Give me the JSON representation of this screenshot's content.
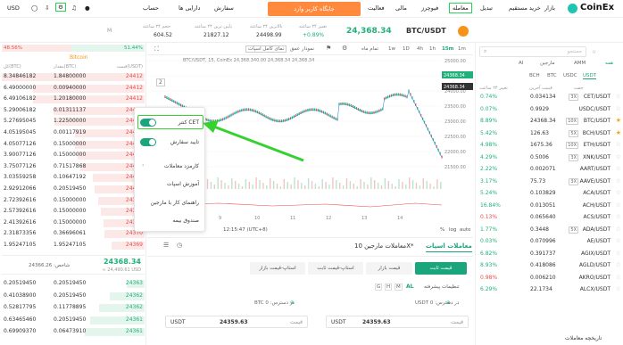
{
  "nav": {
    "logo": "CoinEx",
    "items": [
      "بازار",
      "خرید مستقیم",
      "تبدیل",
      "معامله",
      "فیوچرز",
      "مالی",
      "فعالیت"
    ],
    "highlight_index": 3,
    "banner": "جایگاه کاربر وارد",
    "right_items": [
      "سفارش",
      "دارایی ها",
      "حساب"
    ],
    "currency": "USD"
  },
  "ticker": {
    "pair": "BTC/USDT",
    "price": "24,368.34",
    "stats": [
      {
        "label": "تغییر ۲۴ ساعته",
        "value": "+0.89%"
      },
      {
        "label": "بالاترین ۲۴ ساعته",
        "value": "24498.99"
      },
      {
        "label": "پایین ترین ۲۴ ساعته",
        "value": "21827.12"
      },
      {
        "label": "حجم ۲۴ ساعته",
        "value": "604.52"
      }
    ],
    "m_label": "M"
  },
  "book": {
    "coin_label": "Bitcoin",
    "pct_left": "48.56%",
    "pct_right": "51.44%",
    "headers": [
      "قیمت(USDT)",
      "مقدار(BTC)",
      "کل(BTC)"
    ],
    "asks": [
      [
        "24412",
        "1.84800000",
        "8.34846182"
      ],
      [
        "24412",
        "0.00940000",
        "6.49000000"
      ],
      [
        "24412",
        "1.20180000",
        "6.49106182"
      ],
      [
        "24409",
        "0.01311137",
        "5.29006182"
      ],
      [
        "24407",
        "1.22500000",
        "5.27695045"
      ],
      [
        "24406",
        "0.00117919",
        "4.05195045"
      ],
      [
        "24406",
        "0.15000000",
        "4.05077126"
      ],
      [
        "24405",
        "0.15000000",
        "3.90077126"
      ],
      [
        "24404",
        "0.71517868",
        "3.75077126"
      ],
      [
        "24403",
        "0.10647192",
        "3.03559258"
      ],
      [
        "24401",
        "0.20519450",
        "2.92912066"
      ],
      [
        "24397",
        "0.15000000",
        "2.72392616"
      ],
      [
        "24395",
        "0.15000000",
        "2.57392616"
      ],
      [
        "24391",
        "0.15000000",
        "2.41392616"
      ],
      [
        "24370",
        "0.36696061",
        "2.31873356"
      ],
      [
        "24369",
        "1.95247105",
        "1.95247105"
      ]
    ],
    "mid_price": "24368.34",
    "mid_sub": "≈ 24,490.61 USD",
    "spread_label": "24366.26 :شاخص",
    "bids": [
      [
        "24363",
        "0.20519450",
        "0.20519450"
      ],
      [
        "24362",
        "0.20519450",
        "0.41038900"
      ],
      [
        "24362",
        "0.11778895",
        "0.52817795"
      ],
      [
        "24361",
        "0.20519450",
        "0.63465460"
      ],
      [
        "24361",
        "0.06473910",
        "0.69909370"
      ]
    ]
  },
  "chart": {
    "toolbar": [
      "1m",
      "15m",
      "1h",
      "4h",
      "1D",
      "1w",
      "تمام ماه"
    ],
    "active_interval": "15m",
    "tabs": [
      "نمودار عمق",
      "نمای کامل اسپات"
    ],
    "ohlc_label": "BTC/USDT, 15, CoinEx 24,368.340.00 24,368.34 24,368.34",
    "price_tag": "24368.34",
    "price_tag2": "24368.34",
    "y_ticks": [
      "25000.00",
      "24500.00",
      "24000.00",
      "23500.00",
      "23000.00",
      "22500.00",
      "22000.00",
      "21500.00"
    ],
    "x_ticks": [
      "9",
      "10",
      "11",
      "12",
      "13",
      "14"
    ],
    "time_label": "12:15:47 (UTC+8)",
    "log_label": "log",
    "auto_label": "auto",
    "pct_label": "%",
    "ind_label": "2"
  },
  "menu": {
    "items": [
      "کنتر CET",
      "تایید سفارش",
      "کارمزد معاملات",
      "آموزش اسپات",
      "راهنمای کار با مارجین",
      "صندوق بیمه"
    ]
  },
  "trade": {
    "tabs": [
      "معاملات اسپات",
      "معاملات مارجین 10X*"
    ],
    "order_types": [
      "قیمت ثابت",
      "قیمت بازار",
      "استاپ-قیمت ثابت",
      "استاپ-قیمت بازار"
    ],
    "pair_sel": "AL",
    "fee_label": "تنظیمات پیشرفته",
    "buy_col": {
      "avail": "USDT 0 :در دسترس",
      "price_label": "قیمت",
      "price": "24359.63",
      "unit": "USDT"
    },
    "sell_col": {
      "avail": "BTC 0 :در دسترس",
      "price_label": "قیمت",
      "price": "24359.63",
      "unit": "USDT"
    }
  },
  "market": {
    "search_placeholder": "جستجو",
    "tabs": [
      "همه",
      "AMM",
      "مارجین",
      "AI"
    ],
    "quote_tabs": [
      "USDT",
      "USDC",
      "BTC",
      "BCH"
    ],
    "headers": [
      "جفت",
      "قیمت آخرین",
      "تغییر ۲۴ ساعت"
    ],
    "rows": [
      {
        "pair": "CET/USDT",
        "lev": "3X",
        "price": "0.034134",
        "change": "0.74%",
        "dir": "up",
        "star": false
      },
      {
        "pair": "USDC/USDT",
        "lev": "",
        "price": "0.9929",
        "change": "0.07%",
        "dir": "up",
        "star": false
      },
      {
        "pair": "BTC/USDT",
        "lev": "10X",
        "price": "24368.34",
        "change": "8.89%",
        "dir": "up",
        "star": true
      },
      {
        "pair": "BCH/USDT",
        "lev": "5X",
        "price": "126.63",
        "change": "5.42%",
        "dir": "up",
        "star": true
      },
      {
        "pair": "ETH/USDT",
        "lev": "10X",
        "price": "1675.36",
        "change": "4.98%",
        "dir": "up",
        "star": false
      },
      {
        "pair": "XNK/USDT",
        "lev": "3X",
        "price": "0.5006",
        "change": "4.29%",
        "dir": "up",
        "star": false
      },
      {
        "pair": "AART/USDT",
        "lev": "",
        "price": "0.002071",
        "change": "2.22%",
        "dir": "up",
        "star": false
      },
      {
        "pair": "AAVE/USDT",
        "lev": "3X",
        "price": "75.73",
        "change": "3.17%",
        "dir": "up",
        "star": false
      },
      {
        "pair": "ACA/USDT",
        "lev": "",
        "price": "0.103829",
        "change": "5.24%",
        "dir": "up",
        "star": false
      },
      {
        "pair": "ACH/USDT",
        "lev": "",
        "price": "0.013051",
        "change": "16.84%",
        "dir": "up",
        "star": false
      },
      {
        "pair": "ACS/USDT",
        "lev": "",
        "price": "0.065640",
        "change": "0.13%",
        "dir": "down",
        "star": false
      },
      {
        "pair": "ADA/USDT",
        "lev": "5X",
        "price": "0.3448",
        "change": "1.77%",
        "dir": "up",
        "star": false
      },
      {
        "pair": "AE/USDT",
        "lev": "",
        "price": "0.070996",
        "change": "0.03%",
        "dir": "up",
        "star": false
      },
      {
        "pair": "AGIX/USDT",
        "lev": "",
        "price": "0.391737",
        "change": "6.82%",
        "dir": "up",
        "star": false
      },
      {
        "pair": "AGLD/USDT",
        "lev": "",
        "price": "0.418086",
        "change": "8.93%",
        "dir": "up",
        "star": false
      },
      {
        "pair": "AKRO/USDT",
        "lev": "",
        "price": "0.006210",
        "change": "0.98%",
        "dir": "down",
        "star": false
      },
      {
        "pair": "ALCX/USDT",
        "lev": "",
        "price": "22.1734",
        "change": "6.29%",
        "dir": "up",
        "star": false
      }
    ],
    "history_label": "تاریخچه معاملات"
  },
  "colors": {
    "green": "#22b07a",
    "red": "#e84d4d",
    "arrow": "#34d12f",
    "banner": "#ff8a3d"
  }
}
